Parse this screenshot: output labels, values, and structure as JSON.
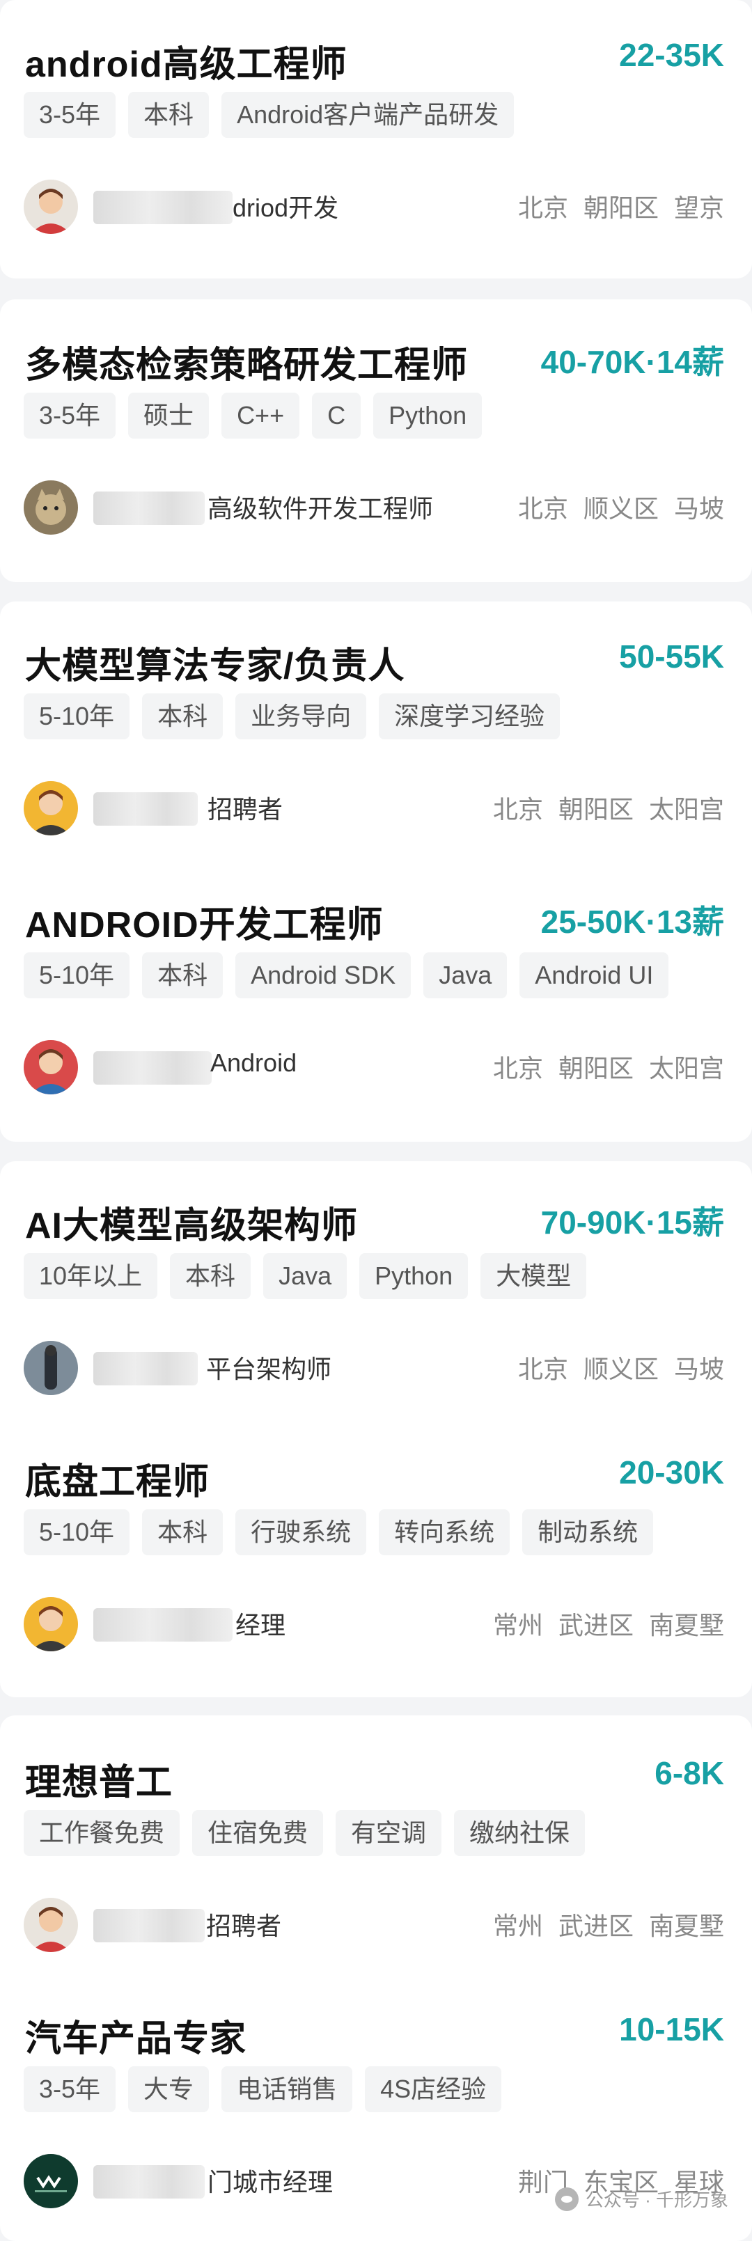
{
  "jobs": [
    {
      "title": "android高级工程师",
      "salary": "22-35K",
      "tags": [
        "3-5年",
        "本科",
        "Android客户端产品研发"
      ],
      "recruiter": "driod开发",
      "location": [
        "北京",
        "朝阳区",
        "望京"
      ],
      "avatar_icon": "avatar-man-red-shirt-icon"
    },
    {
      "title": "多模态检索策略研发工程师",
      "salary": "40-70K·14薪",
      "tags": [
        "3-5年",
        "硕士",
        "C++",
        "C",
        "Python"
      ],
      "recruiter": "高级软件开发工程师",
      "location": [
        "北京",
        "顺义区",
        "马坡"
      ],
      "avatar_icon": "avatar-cat-photo-icon"
    },
    {
      "title": "大模型算法专家/负责人",
      "salary": "50-55K",
      "tags": [
        "5-10年",
        "本科",
        "业务导向",
        "深度学习经验"
      ],
      "recruiter": "招聘者",
      "location": [
        "北京",
        "朝阳区",
        "太阳宫"
      ],
      "avatar_icon": "avatar-man-yellow-icon"
    },
    {
      "title": "ANDROID开发工程师",
      "salary": "25-50K·13薪",
      "tags": [
        "5-10年",
        "本科",
        "Android SDK",
        "Java",
        "Android UI"
      ],
      "recruiter": "Android",
      "location": [
        "北京",
        "朝阳区",
        "太阳宫"
      ],
      "avatar_icon": "avatar-man-red-icon"
    },
    {
      "title": "AI大模型高级架构师",
      "salary": "70-90K·15薪",
      "tags": [
        "10年以上",
        "本科",
        "Java",
        "Python",
        "大模型"
      ],
      "recruiter": "平台架构师",
      "location": [
        "北京",
        "顺义区",
        "马坡"
      ],
      "avatar_icon": "avatar-person-photo-icon"
    },
    {
      "title": "底盘工程师",
      "salary": "20-30K",
      "tags": [
        "5-10年",
        "本科",
        "行驶系统",
        "转向系统",
        "制动系统"
      ],
      "recruiter": "经理",
      "location": [
        "常州",
        "武进区",
        "南夏墅"
      ],
      "avatar_icon": "avatar-man-yellow-icon"
    },
    {
      "title": "理想普工",
      "salary": "6-8K",
      "tags": [
        "工作餐免费",
        "住宿免费",
        "有空调",
        "缴纳社保"
      ],
      "recruiter": "招聘者",
      "location": [
        "常州",
        "武进区",
        "南夏墅"
      ],
      "avatar_icon": "avatar-man-red-shirt-icon"
    },
    {
      "title": "汽车产品专家",
      "salary": "10-15K",
      "tags": [
        "3-5年",
        "大专",
        "电话销售",
        "4S店经验"
      ],
      "recruiter": "门城市经理",
      "location": [
        "荆门",
        "东宝区",
        "星球"
      ],
      "avatar_icon": "avatar-brand-logo-icon"
    }
  ],
  "watermark": "公众号 · 千形万象",
  "colors": {
    "salary": "#17a0a4",
    "tag_bg": "#f3f4f5",
    "page_bg": "#f3f4f6"
  }
}
